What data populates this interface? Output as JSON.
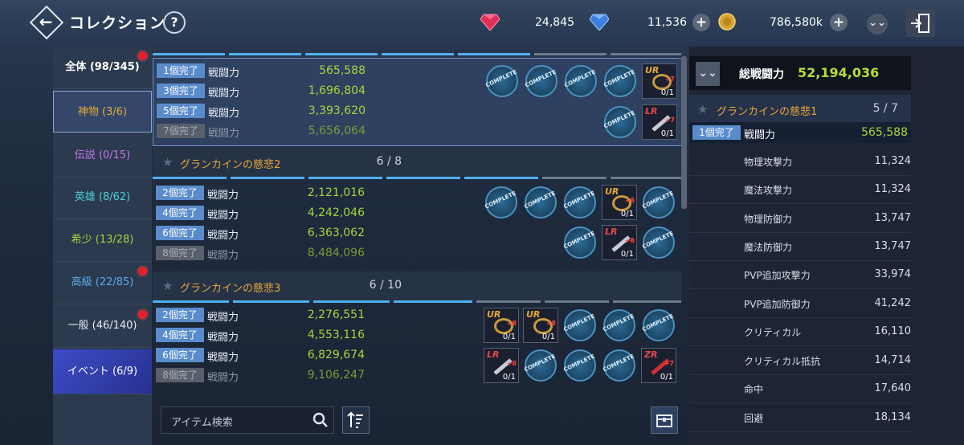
{
  "header": {
    "title": "コレクション",
    "help_label": "?",
    "currencies": [
      {
        "icon": "red-gem-icon",
        "value": "24,845",
        "color": "#e0305a"
      },
      {
        "icon": "blue-gem-icon",
        "value": "11,536",
        "color": "#3b7fe0"
      },
      {
        "icon": "gold-coin-icon",
        "value": "786,580k",
        "color": "#d7a431"
      }
    ]
  },
  "sidebar": {
    "items": [
      {
        "label": "全体 (98/345)",
        "color": "#ffffff",
        "dot": true
      },
      {
        "label": "神物 (3/6)",
        "color": "#e7a93a",
        "dot": false
      },
      {
        "label": "伝説 (0/15)",
        "color": "#c276e8",
        "dot": false
      },
      {
        "label": "英雄 (8/62)",
        "color": "#4ad0d8",
        "dot": false
      },
      {
        "label": "希少 (13/28)",
        "color": "#a9d43a",
        "dot": false
      },
      {
        "label": "高級 (22/85)",
        "color": "#5aaaf0",
        "dot": true
      },
      {
        "label": "一般 (46/140)",
        "color": "#e6ecf5",
        "dot": true
      },
      {
        "label": "イベント (6/9)",
        "color": "#ffffff",
        "dot": false
      }
    ]
  },
  "main": {
    "groups": [
      {
        "name": "",
        "count": "",
        "rows": [
          {
            "badge": "1個完了",
            "label": "戦闘力",
            "value": "565,588",
            "done": true
          },
          {
            "badge": "3個完了",
            "label": "戦闘力",
            "value": "1,696,804",
            "done": true
          },
          {
            "badge": "5個完了",
            "label": "戦闘力",
            "value": "3,393,620",
            "done": true
          },
          {
            "badge": "7個完了",
            "label": "戦闘力",
            "value": "5,656,064",
            "done": false
          }
        ]
      },
      {
        "name": "グランカインの慈悲2",
        "count": "6 / 8",
        "rows": [
          {
            "badge": "2個完了",
            "label": "戦闘力",
            "value": "2,121,016",
            "done": true
          },
          {
            "badge": "4個完了",
            "label": "戦闘力",
            "value": "4,242,046",
            "done": true
          },
          {
            "badge": "6個完了",
            "label": "戦闘力",
            "value": "6,363,062",
            "done": true
          },
          {
            "badge": "8個完了",
            "label": "戦闘力",
            "value": "8,484,096",
            "done": false
          }
        ]
      },
      {
        "name": "グランカインの慈悲3",
        "count": "6 / 10",
        "rows": [
          {
            "badge": "2個完了",
            "label": "戦闘力",
            "value": "2,276,551",
            "done": true
          },
          {
            "badge": "4個完了",
            "label": "戦闘力",
            "value": "4,553,116",
            "done": true
          },
          {
            "badge": "6個完了",
            "label": "戦闘力",
            "value": "6,829,674",
            "done": true
          },
          {
            "badge": "8個完了",
            "label": "戦闘力",
            "value": "9,106,247",
            "done": false
          }
        ]
      }
    ],
    "complete_text": "COMPLETE",
    "item_count_text": "0/1"
  },
  "search": {
    "placeholder": "アイテム検索"
  },
  "right_panel": {
    "total_label": "総戦闘力",
    "total_value": "52,194,036",
    "group_name": "グランカインの慈悲1",
    "group_count": "5 / 7",
    "selected": {
      "badge": "1個完了",
      "label": "戦闘力",
      "value": "565,588"
    },
    "stats": [
      {
        "label": "物理攻撃力",
        "value": "11,324"
      },
      {
        "label": "魔法攻撃力",
        "value": "11,324"
      },
      {
        "label": "物理防御力",
        "value": "13,747"
      },
      {
        "label": "魔法防御力",
        "value": "13,747"
      },
      {
        "label": "PVP追加攻撃力",
        "value": "33,974"
      },
      {
        "label": "PVP追加防御力",
        "value": "41,242"
      },
      {
        "label": "クリティカル",
        "value": "16,110"
      },
      {
        "label": "クリティカル抵抗",
        "value": "14,714"
      },
      {
        "label": "命中",
        "value": "17,640"
      },
      {
        "label": "回避",
        "value": "18,134"
      }
    ]
  }
}
